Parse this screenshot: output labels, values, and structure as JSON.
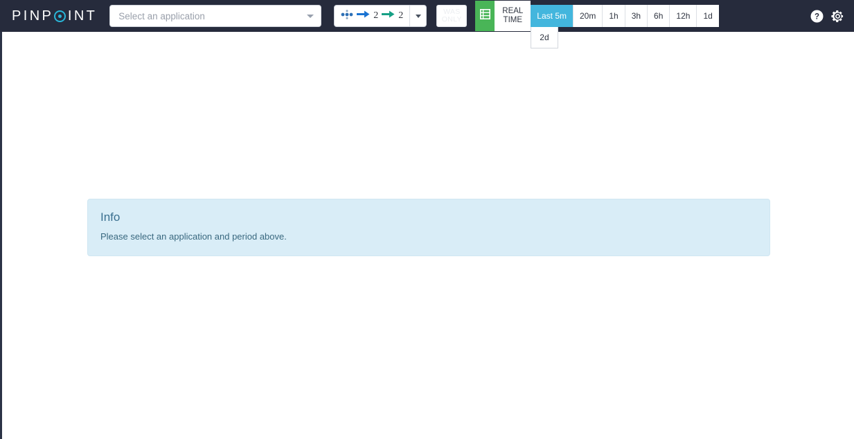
{
  "brand": {
    "name_before_o": "PINP",
    "name_after_o": "INT",
    "accent_color": "#29b6d8"
  },
  "header": {
    "background_color": "#262b3c",
    "app_select": {
      "placeholder": "Select an application",
      "value": "",
      "caret_icon": "chevron-down-icon"
    },
    "counter": {
      "nodes_icon": "dots-cluster-icon",
      "inbound_icon": "arrow-right-blue-icon",
      "inbound_count": "2",
      "outbound_icon": "arrow-right-green-icon",
      "outbound_count": "2",
      "caret_icon": "chevron-down-icon"
    },
    "was_only": {
      "line1": "WAS",
      "line2": "ONLY",
      "disabled": true
    },
    "realtime": {
      "grid_icon": "table-grid-icon",
      "label_line1": "REAL",
      "label_line2": "TIME",
      "icon_background": "#49b557"
    },
    "time_ranges": [
      {
        "label": "Last 5m",
        "active": true
      },
      {
        "label": "20m",
        "active": false
      },
      {
        "label": "1h",
        "active": false
      },
      {
        "label": "3h",
        "active": false
      },
      {
        "label": "6h",
        "active": false
      },
      {
        "label": "12h",
        "active": false
      },
      {
        "label": "1d",
        "active": false
      }
    ],
    "time_range_dropdown": {
      "open": true,
      "items": [
        {
          "label": "2d"
        }
      ]
    },
    "active_range_color": "#43b6dd",
    "right_icons": [
      {
        "name": "help-icon",
        "glyph": "?"
      },
      {
        "name": "gear-icon",
        "glyph": "gear"
      }
    ]
  },
  "info_panel": {
    "title": "Info",
    "message": "Please select an application and period above.",
    "background_color": "#d9edf7",
    "text_color": "#3a6f8f"
  }
}
